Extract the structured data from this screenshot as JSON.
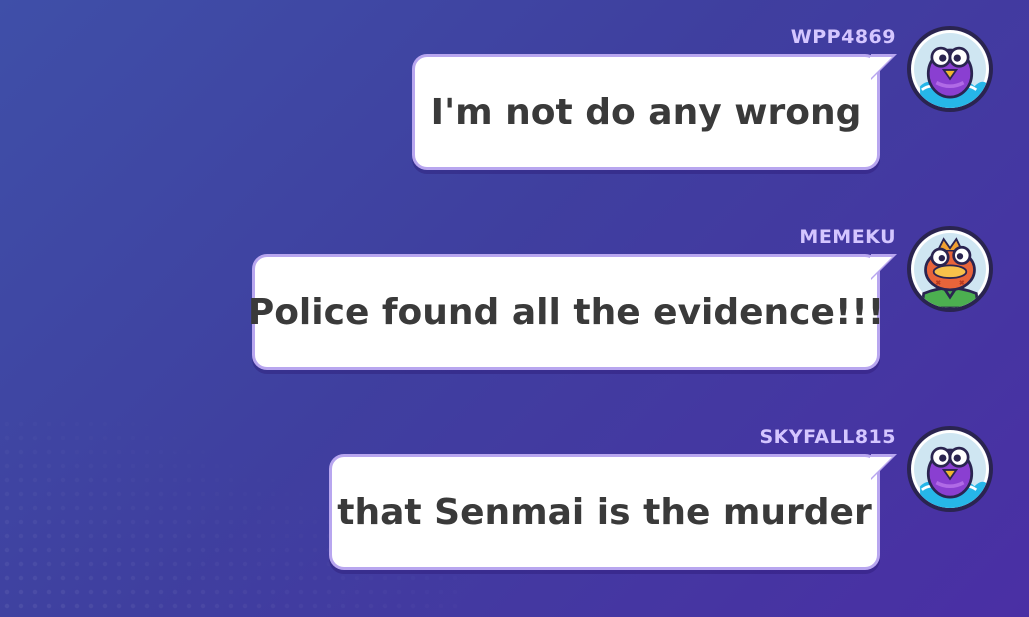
{
  "messages": [
    {
      "username": "WPP4869",
      "text": "I'm not do any wrong",
      "avatar": "purple-bird-icon"
    },
    {
      "username": "MEMEKU",
      "text": "Police found all the evidence!!!",
      "avatar": "orange-fish-icon"
    },
    {
      "username": "SKYFALL815",
      "text": "that Senmai is the murder",
      "avatar": "purple-bird-icon"
    }
  ],
  "colors": {
    "background_start": "#3f4fa8",
    "background_end": "#4a2fa4",
    "username": "#d4c6ff",
    "bubble": "#ffffff",
    "bubble_border": "#b8a6ef",
    "message_text": "#3a3a3a"
  }
}
